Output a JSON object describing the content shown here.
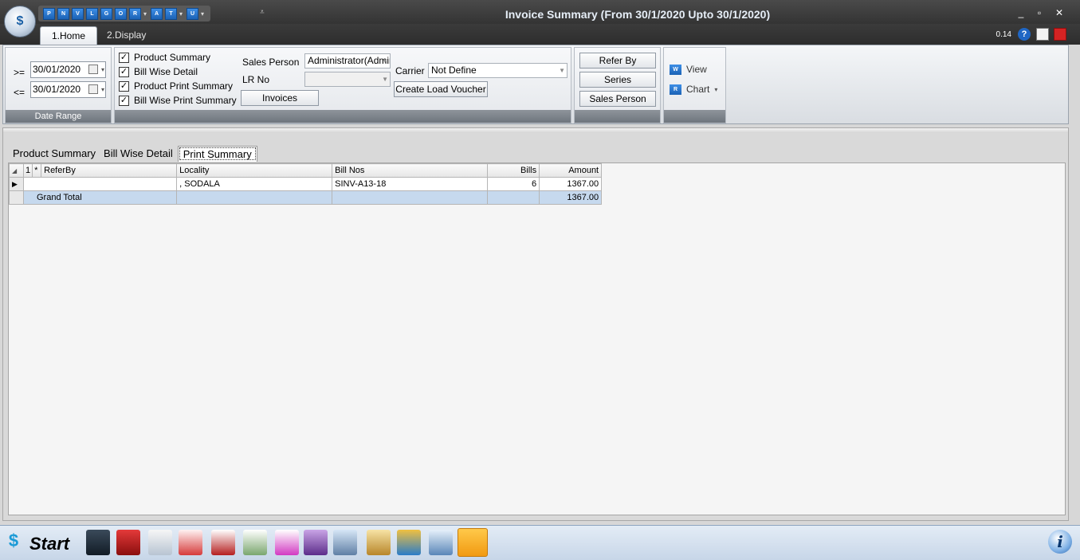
{
  "window": {
    "title": "Invoice Summary (From 30/1/2020 Upto 30/1/2020)",
    "minimize": "_",
    "maximize": "▫",
    "close": "✕"
  },
  "qat": [
    "P",
    "N",
    "V",
    "L",
    "G",
    "O",
    "R",
    "A",
    "T",
    "U"
  ],
  "ribbon_tabs": [
    "1.Home",
    "2.Display"
  ],
  "zoom": "0.14",
  "date_range": {
    "from_op": ">=",
    "from": "30/01/2020",
    "to_op": "<=",
    "to": "30/01/2020",
    "label": "Date Range"
  },
  "options": {
    "checks": [
      {
        "label": "Product Summary",
        "checked": true
      },
      {
        "label": "Bill Wise Detail",
        "checked": true
      },
      {
        "label": "Product Print Summary",
        "checked": true
      },
      {
        "label": "Bill Wise Print Summary",
        "checked": true
      }
    ],
    "sales_person_label": "Sales Person",
    "sales_person_value": "Administrator(Admir",
    "lr_no_label": "LR No",
    "lr_no_value": "",
    "invoices_button": "Invoices",
    "carrier_label": "Carrier",
    "carrier_value": "Not Define",
    "create_load_voucher": "Create Load Voucher"
  },
  "group_buttons": {
    "refer_by": "Refer By",
    "series": "Series",
    "sales_person": "Sales Person"
  },
  "view_group": {
    "view": "View",
    "chart": "Chart"
  },
  "page_tabs": [
    "Product Summary",
    "Bill Wise Detail",
    "Print Summary"
  ],
  "active_page_tab": "Print Summary",
  "grid": {
    "group_num": "1",
    "columns": [
      "ReferBy",
      "Locality",
      "Bill Nos",
      "Bills",
      "Amount"
    ],
    "rows": [
      {
        "refer_by": "",
        "locality": ", SODALA",
        "bill_nos": "SINV-A13-18",
        "bills": "6",
        "amount": "1367.00"
      }
    ],
    "total": {
      "label": "Grand Total",
      "amount": "1367.00"
    }
  },
  "taskbar": {
    "start": "Start",
    "icons": [
      "dark-book-icon",
      "red-tag-icon",
      "print-stand-icon",
      "credit-book-icon",
      "p-file-icon",
      "re-clipboard-icon",
      "pe-clipboard-icon",
      "cash-register-icon",
      "exchange-icon",
      "money-bag-icon",
      "shapes-icon",
      "printer-icon",
      "bar-chart-icon"
    ]
  },
  "colors": {
    "titlebar": "#3a3a3a",
    "accent": "#1b62b5",
    "total_row": "#c6d9ee"
  }
}
